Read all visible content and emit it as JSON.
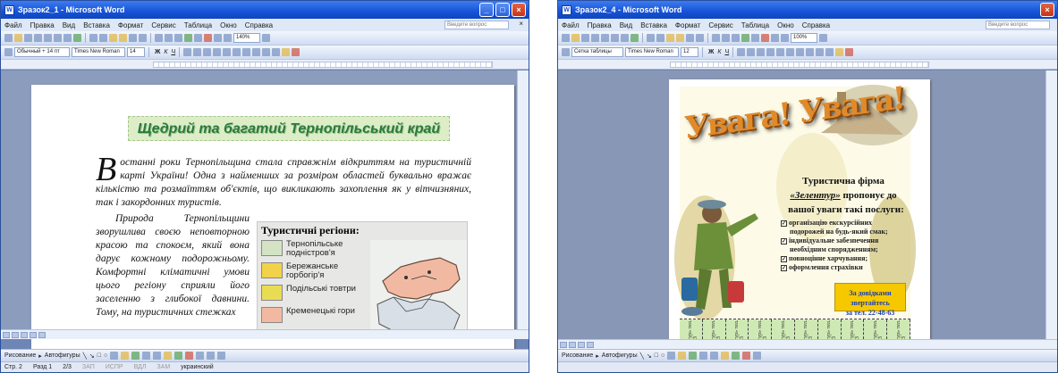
{
  "window1": {
    "title": "Зразок2_1 - Microsoft Word",
    "menu": [
      "Файл",
      "Правка",
      "Вид",
      "Вставка",
      "Формат",
      "Сервис",
      "Таблица",
      "Окно",
      "Справка"
    ],
    "help_placeholder": "Введите вопрос",
    "style_combo": "Обычный + 14 пт",
    "font_combo": "Times New Roman",
    "size_combo": "14",
    "zoom_combo": "140%",
    "heading": "Щедрий та багатий Тернопільський край",
    "dropcap": "В",
    "para1": "останні роки Тернопільщина стала справжнім відкриттям на туристичній карті України! Одна з найменших за розміром областей буквально вражає кількістю та розмаїттям об'єктів, що викликають захоплення як у вітчизняних, так і закордонних туристів.",
    "para2": "Природа Тернопільщини зворушлива своєю неповторною красою та спокоєм, який вона дарує кожному подорожньому. Комфортні кліматичні умови цього регіону сприяли його заселенню з глибокої давнини. Тому, на туристичних стежках",
    "legend": {
      "title": "Туристичні регіони:",
      "items": [
        {
          "label": "Тернопільське подністров'я",
          "color": "#d3e3c4"
        },
        {
          "label": "Бережанське горбогір'я",
          "color": "#f1d24a"
        },
        {
          "label": "Подільські товтри",
          "color": "#e9dc55"
        },
        {
          "label": "Кременецькі гори",
          "color": "#f2b9a2"
        }
      ]
    },
    "drawbar": {
      "draw": "Рисование",
      "autoshapes": "Автофигуры"
    },
    "status": {
      "page": "Стр. 2",
      "section": "Разд 1",
      "pos": "2/3",
      "zap": "ЗАП",
      "ispr": "ИСПР",
      "vdl": "ВДЛ",
      "zam": "ЗАМ",
      "lang": "украинский"
    }
  },
  "window2": {
    "title": "Зразок2_4 - Microsoft Word",
    "menu": [
      "Файл",
      "Правка",
      "Вид",
      "Вставка",
      "Формат",
      "Сервис",
      "Таблица",
      "Окно",
      "Справка"
    ],
    "help_placeholder": "Введите вопрос",
    "style_combo": "Сетка таблицы",
    "font_combo": "Times New Roman",
    "size_combo": "12",
    "zoom_combo": "100%",
    "poster_title": "Увага! Увага!",
    "firm_line1": "Туристична фірма",
    "firm_name": "«Зелентур»",
    "firm_line2": "пропонує до",
    "firm_line3": "вашої уваги такі послуги:",
    "services": [
      "організацію екскурсійних",
      "подорожей на будь-який смак;",
      "індивідуальне забезпечення",
      "необхідним спорядженням;",
      "повноцінне харчування;",
      "оформлення страхівки"
    ],
    "contact_line1": "За довідками звертайтесь",
    "contact_line2": "за тел. 22-48-63",
    "tear_tab": "Фірма «Зелентур» тел. 22-48-63",
    "drawbar": {
      "draw": "Рисование",
      "autoshapes": "Автофигуры"
    }
  }
}
